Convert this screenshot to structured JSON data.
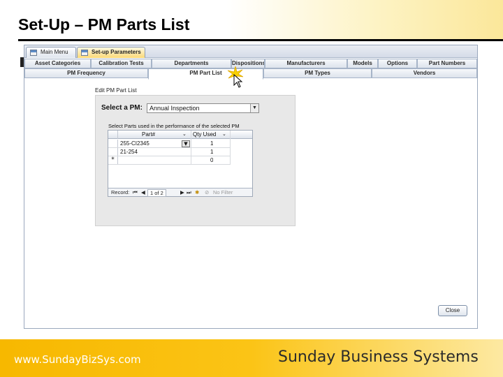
{
  "slide": {
    "title": "Set-Up – PM Parts List",
    "footer_url": "www.SundayBizSys.com",
    "footer_company": "Sunday Business Systems"
  },
  "app": {
    "doc_tabs": [
      {
        "label": "Main Menu",
        "active": false
      },
      {
        "label": "Set-up Parameters",
        "active": true
      }
    ],
    "tabs_row1": [
      "Asset Categories",
      "Calibration Tests",
      "Departments",
      "Dispositions",
      "Manufacturers",
      "Models",
      "Options",
      "Part Numbers"
    ],
    "tabs_row2": [
      "PM Frequency",
      "PM Part List",
      "PM Types",
      "Vendors"
    ],
    "active_tab": "PM Part List",
    "form": {
      "caption": "Edit PM Part List",
      "select_pm_label": "Select a PM:",
      "select_pm_value": "Annual Inspection",
      "subform_label": "Select Parts used in the performance of the selected PM",
      "columns": [
        "Part#",
        "Qty Used"
      ],
      "rows": [
        {
          "part": "255-CI2345",
          "qty": "1"
        },
        {
          "part": "21-254",
          "qty": "1"
        }
      ],
      "new_row": {
        "marker": "*",
        "qty": "0"
      },
      "nav": {
        "record_label": "Record:",
        "position": "1 of 2",
        "no_filter": "No Filter"
      }
    },
    "close_label": "Close"
  },
  "colors": {
    "footer_start": "#f7b800",
    "active_doc_tab": "#fbd977"
  }
}
